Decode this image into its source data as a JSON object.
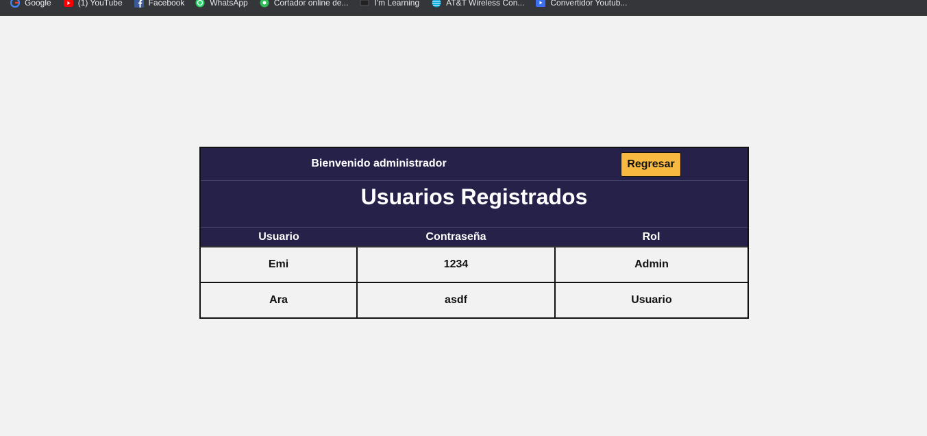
{
  "bookmarks": [
    {
      "label": "Google",
      "icon": "google-icon"
    },
    {
      "label": "(1) YouTube",
      "icon": "youtube-icon"
    },
    {
      "label": "Facebook",
      "icon": "facebook-icon"
    },
    {
      "label": "WhatsApp",
      "icon": "whatsapp-icon"
    },
    {
      "label": "Cortador online de...",
      "icon": "cutter-icon"
    },
    {
      "label": "I'm Learning",
      "icon": "learning-icon"
    },
    {
      "label": "AT&T Wireless Con...",
      "icon": "att-icon"
    },
    {
      "label": "Convertidor Youtub...",
      "icon": "converter-icon"
    }
  ],
  "header": {
    "welcome": "Bienvenido administrador",
    "back_label": "Regresar",
    "title": "Usuarios Registrados"
  },
  "table": {
    "columns": [
      "Usuario",
      "Contraseña",
      "Rol"
    ],
    "rows": [
      [
        "Emi",
        "1234",
        "Admin"
      ],
      [
        "Ara",
        "asdf",
        "Usuario"
      ]
    ]
  },
  "colors": {
    "header_bg": "#262148",
    "button_bg": "#f8b941",
    "page_bg": "#f2f2f2"
  }
}
